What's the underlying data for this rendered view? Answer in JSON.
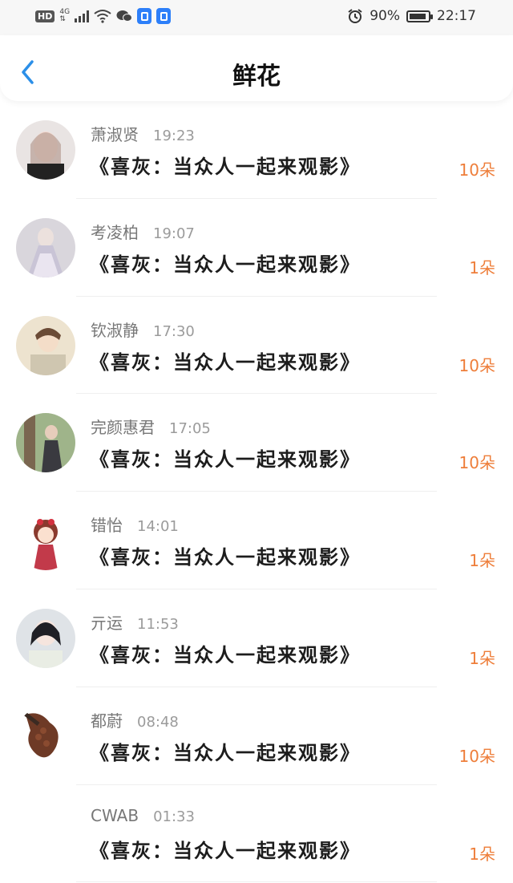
{
  "status_bar": {
    "hd": "HD",
    "network": "4G",
    "battery_percent": "90%",
    "battery_level": 0.9,
    "clock": "22:17"
  },
  "header": {
    "title": "鲜花"
  },
  "items": [
    {
      "name": "萧淑贤",
      "time": "19:23",
      "movie": "《喜灰：当众人一起来观影》",
      "count": "10朵"
    },
    {
      "name": "考凌柏",
      "time": "19:07",
      "movie": "《喜灰：当众人一起来观影》",
      "count": "1朵"
    },
    {
      "name": "钦淑静",
      "time": "17:30",
      "movie": "《喜灰：当众人一起来观影》",
      "count": "10朵"
    },
    {
      "name": "完颜惠君",
      "time": "17:05",
      "movie": "《喜灰：当众人一起来观影》",
      "count": "10朵"
    },
    {
      "name": "错怡",
      "time": "14:01",
      "movie": "《喜灰：当众人一起来观影》",
      "count": "1朵"
    },
    {
      "name": "亓运",
      "time": "11:53",
      "movie": "《喜灰：当众人一起来观影》",
      "count": "1朵"
    },
    {
      "name": "都蔚",
      "time": "08:48",
      "movie": "《喜灰：当众人一起来观影》",
      "count": "10朵"
    },
    {
      "name": "CWAB",
      "time": "01:33",
      "movie": "《喜灰：当众人一起来观影》",
      "count": "1朵"
    }
  ],
  "colors": {
    "accent_back": "#2b8fe8",
    "count": "#ee7e3a"
  }
}
